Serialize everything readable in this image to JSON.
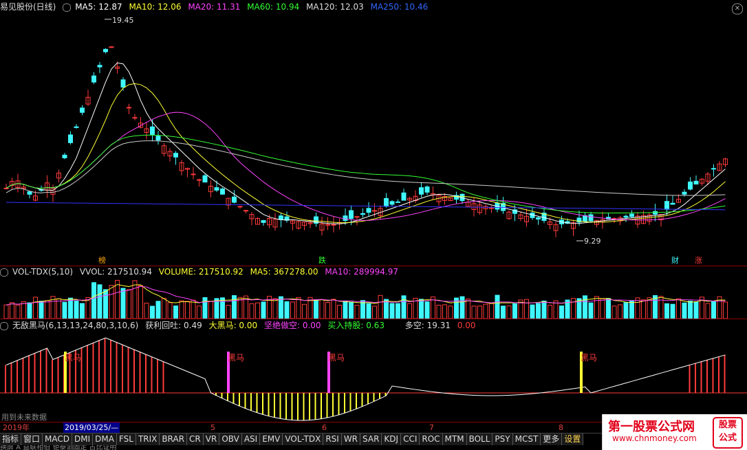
{
  "header": {
    "stock": "易见股份(日线)",
    "ma5": "MA5: 12.87",
    "ma10": "MA10: 12.06",
    "ma20": "MA20: 11.31",
    "ma60": "MA60: 10.94",
    "ma120": "MA120: 12.03",
    "ma250": "MA250: 10.46"
  },
  "price_annotations": {
    "high": "19.45",
    "low": "9.29",
    "marker_bang": "榜",
    "marker_die": "跌",
    "marker_cai": "财",
    "marker_zhang": "涨"
  },
  "volume_header": {
    "name": "VOL-TDX(5,10)",
    "vvol": "VVOL: 217510.94",
    "volume": "VOLUME: 217510.92",
    "ma5": "MA5: 367278.00",
    "ma10": "MA10: 289994.97"
  },
  "indicator_header": {
    "name": "无敌黑马(6,13,13,24,80,3,10,6)",
    "profit": "获利回吐: 0.49",
    "heima": "大黑马: 0.00",
    "sell": "坚绝做空: 0.00",
    "buy": "买入持股: 0.63",
    "duokong": "多空: 19.31",
    "extra": "0.00"
  },
  "indicator_labels": {
    "h1": "黑马",
    "h2": "黑马",
    "h3": "黑马",
    "h4": "黑马"
  },
  "future_text": "用到未来数据",
  "dates": {
    "year": "2019年",
    "selected": "2019/03/25/—",
    "m5": "5",
    "m6": "6",
    "m7": "7",
    "m8": "8"
  },
  "tabs": [
    "指标",
    "窗口",
    "MACD",
    "DMI",
    "DMA",
    "FSL",
    "TRIX",
    "BRAR",
    "CR",
    "VR",
    "OBV",
    "ASI",
    "EMV",
    "VOL-TDX",
    "RSI",
    "WR",
    "SAR",
    "KDJ",
    "CCI",
    "ROC",
    "MTM",
    "BOLL",
    "PSY",
    "MCST",
    "更多",
    "设置"
  ],
  "bottom_text": "换屏 A 益联相伯 钜泰泗固定 占比证明",
  "watermark": {
    "title": "第一股票公式网",
    "url": "www.chnmoney.com",
    "badge1": "股票",
    "badge2": "公式"
  },
  "colors": {
    "up": "#ff3b3b",
    "down": "#3ff7ff",
    "ma5": "#ffffff",
    "ma10": "#ffff33",
    "ma20": "#ff44ff",
    "ma60": "#33ff33",
    "ma250": "#3333ff"
  }
}
